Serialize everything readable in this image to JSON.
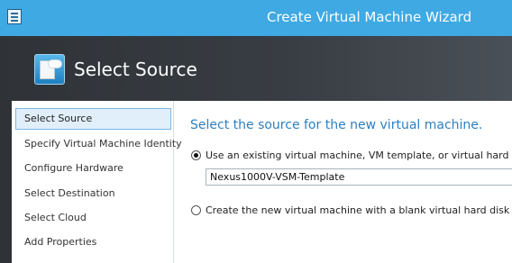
{
  "window": {
    "title": "Create Virtual Machine Wizard",
    "accent": "#3fa9e4"
  },
  "header": {
    "title": "Select Source",
    "icon": "select-source-icon"
  },
  "sidebar": {
    "items": [
      {
        "label": "Select Source",
        "selected": true
      },
      {
        "label": "Specify Virtual Machine Identity",
        "selected": false
      },
      {
        "label": "Configure Hardware",
        "selected": false
      },
      {
        "label": "Select Destination",
        "selected": false
      },
      {
        "label": "Select Cloud",
        "selected": false
      },
      {
        "label": "Add Properties",
        "selected": false
      }
    ]
  },
  "main": {
    "heading": "Select the source for the new virtual machine.",
    "option_existing": {
      "label": "Use an existing virtual machine, VM template, or virtual hard disk.",
      "checked": true
    },
    "source_value": "Nexus1000V-VSM-Template",
    "option_blank": {
      "label": "Create the new virtual machine with a blank virtual hard disk",
      "checked": false
    },
    "heading_color": "#2d7fc0"
  }
}
